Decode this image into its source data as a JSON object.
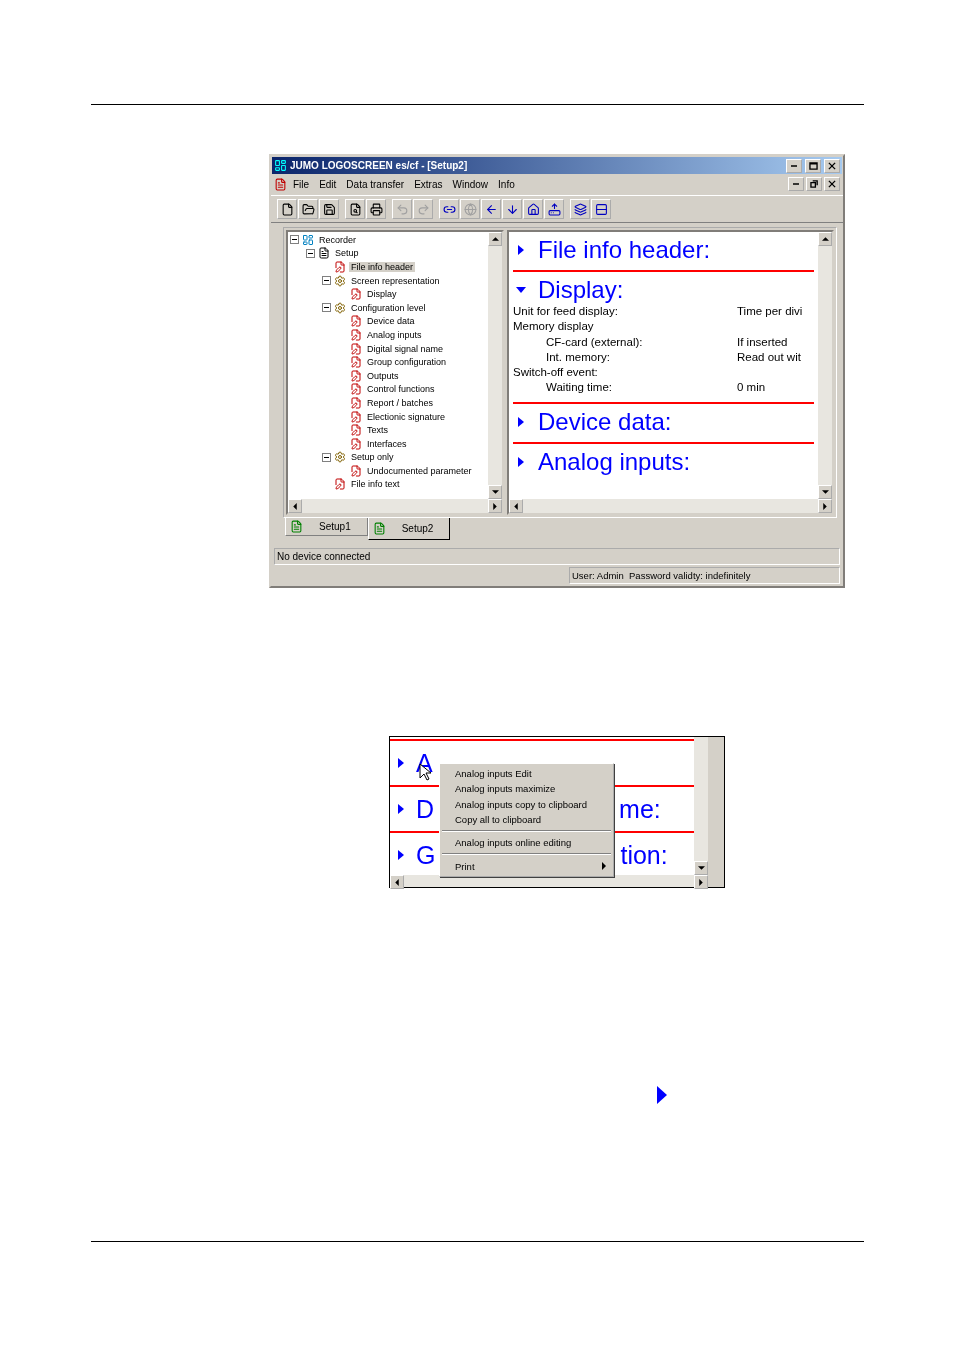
{
  "window": {
    "title": "JUMO LOGOSCREEN es/cf - [Setup2]"
  },
  "menu": [
    "File",
    "Edit",
    "Data transfer",
    "Extras",
    "Window",
    "Info"
  ],
  "toolbar": [
    [
      {
        "disabled": false
      },
      {
        "disabled": false
      },
      {
        "disabled": false
      }
    ],
    [
      {
        "disabled": false
      },
      {
        "disabled": false
      }
    ],
    [
      {
        "disabled": true
      },
      {
        "disabled": true
      }
    ],
    [
      {
        "disabled": false
      },
      {
        "disabled": true
      },
      {
        "disabled": false
      },
      {
        "disabled": false
      },
      {
        "disabled": false
      },
      {
        "disabled": false
      }
    ],
    [
      {
        "disabled": false
      },
      {
        "disabled": false
      }
    ]
  ],
  "tree": [
    {
      "label": "Recorder",
      "kind": "recorder",
      "selected": false,
      "expanded": true,
      "children": [
        {
          "label": "Setup",
          "kind": "setup",
          "selected": false,
          "expanded": true,
          "children": [
            {
              "label": "File info header",
              "kind": "page",
              "selected": true
            },
            {
              "label": "Screen representation",
              "kind": "group",
              "selected": false,
              "expanded": true,
              "children": [
                {
                  "label": "Display",
                  "kind": "page",
                  "selected": false
                }
              ]
            },
            {
              "label": "Configuration level",
              "kind": "group",
              "selected": false,
              "expanded": true,
              "children": [
                {
                  "label": "Device data",
                  "kind": "page",
                  "selected": false
                },
                {
                  "label": "Analog inputs",
                  "kind": "page",
                  "selected": false
                },
                {
                  "label": "Digital signal name",
                  "kind": "page",
                  "selected": false
                },
                {
                  "label": "Group configuration",
                  "kind": "page",
                  "selected": false
                },
                {
                  "label": "Outputs",
                  "kind": "page",
                  "selected": false
                },
                {
                  "label": "Control functions",
                  "kind": "page",
                  "selected": false
                },
                {
                  "label": "Report / batches",
                  "kind": "page",
                  "selected": false
                },
                {
                  "label": "Electionic signature",
                  "kind": "page",
                  "selected": false
                },
                {
                  "label": "Texts",
                  "kind": "page",
                  "selected": false
                },
                {
                  "label": "Interfaces",
                  "kind": "page",
                  "selected": false
                }
              ]
            },
            {
              "label": "Setup only",
              "kind": "group",
              "selected": false,
              "expanded": true,
              "children": [
                {
                  "label": "Undocumented parameter",
                  "kind": "page",
                  "selected": false
                }
              ]
            },
            {
              "label": "File info text",
              "kind": "page",
              "selected": false
            }
          ]
        }
      ]
    }
  ],
  "sections": [
    {
      "title": "File info header:",
      "expanded": false
    },
    {
      "title": "Display:",
      "expanded": true,
      "rows": [
        {
          "kind": "main",
          "label": "Unit for feed display:",
          "value": "Time per divi"
        },
        {
          "kind": "main",
          "label": "Memory display"
        },
        {
          "kind": "sub",
          "label": "CF-card (external):",
          "value": "If inserted"
        },
        {
          "kind": "sub",
          "label": "Int. memory:",
          "value": "Read out wit"
        },
        {
          "kind": "main",
          "label": "Switch-off event:"
        },
        {
          "kind": "sub",
          "label": "Waiting time:",
          "value": "0 min"
        }
      ]
    },
    {
      "title": "Device data:",
      "expanded": false
    },
    {
      "title": "Analog inputs:",
      "expanded": false
    }
  ],
  "tabs": [
    {
      "label": "Setup1",
      "selected": false
    },
    {
      "label": "Setup2",
      "selected": true
    }
  ],
  "status_bar": {
    "message": "No device connected",
    "user": "User: Admin  Password validty: indefinitely"
  },
  "detail": {
    "headings": [
      {
        "start": "A"
      },
      {
        "start": "D",
        "end": "me:"
      },
      {
        "start": "G",
        "end": "tion:"
      }
    ],
    "context_menu": [
      {
        "kind": "item",
        "label": "Analog inputs Edit"
      },
      {
        "kind": "item",
        "label": "Analog inputs maximize"
      },
      {
        "kind": "item",
        "label": "Analog inputs copy to clipboard"
      },
      {
        "kind": "item",
        "label": "Copy all to clipboard"
      },
      {
        "kind": "separator"
      },
      {
        "kind": "item",
        "label": "Analog inputs online editing"
      },
      {
        "kind": "separator"
      },
      {
        "kind": "submenu",
        "label": "Print"
      }
    ]
  }
}
